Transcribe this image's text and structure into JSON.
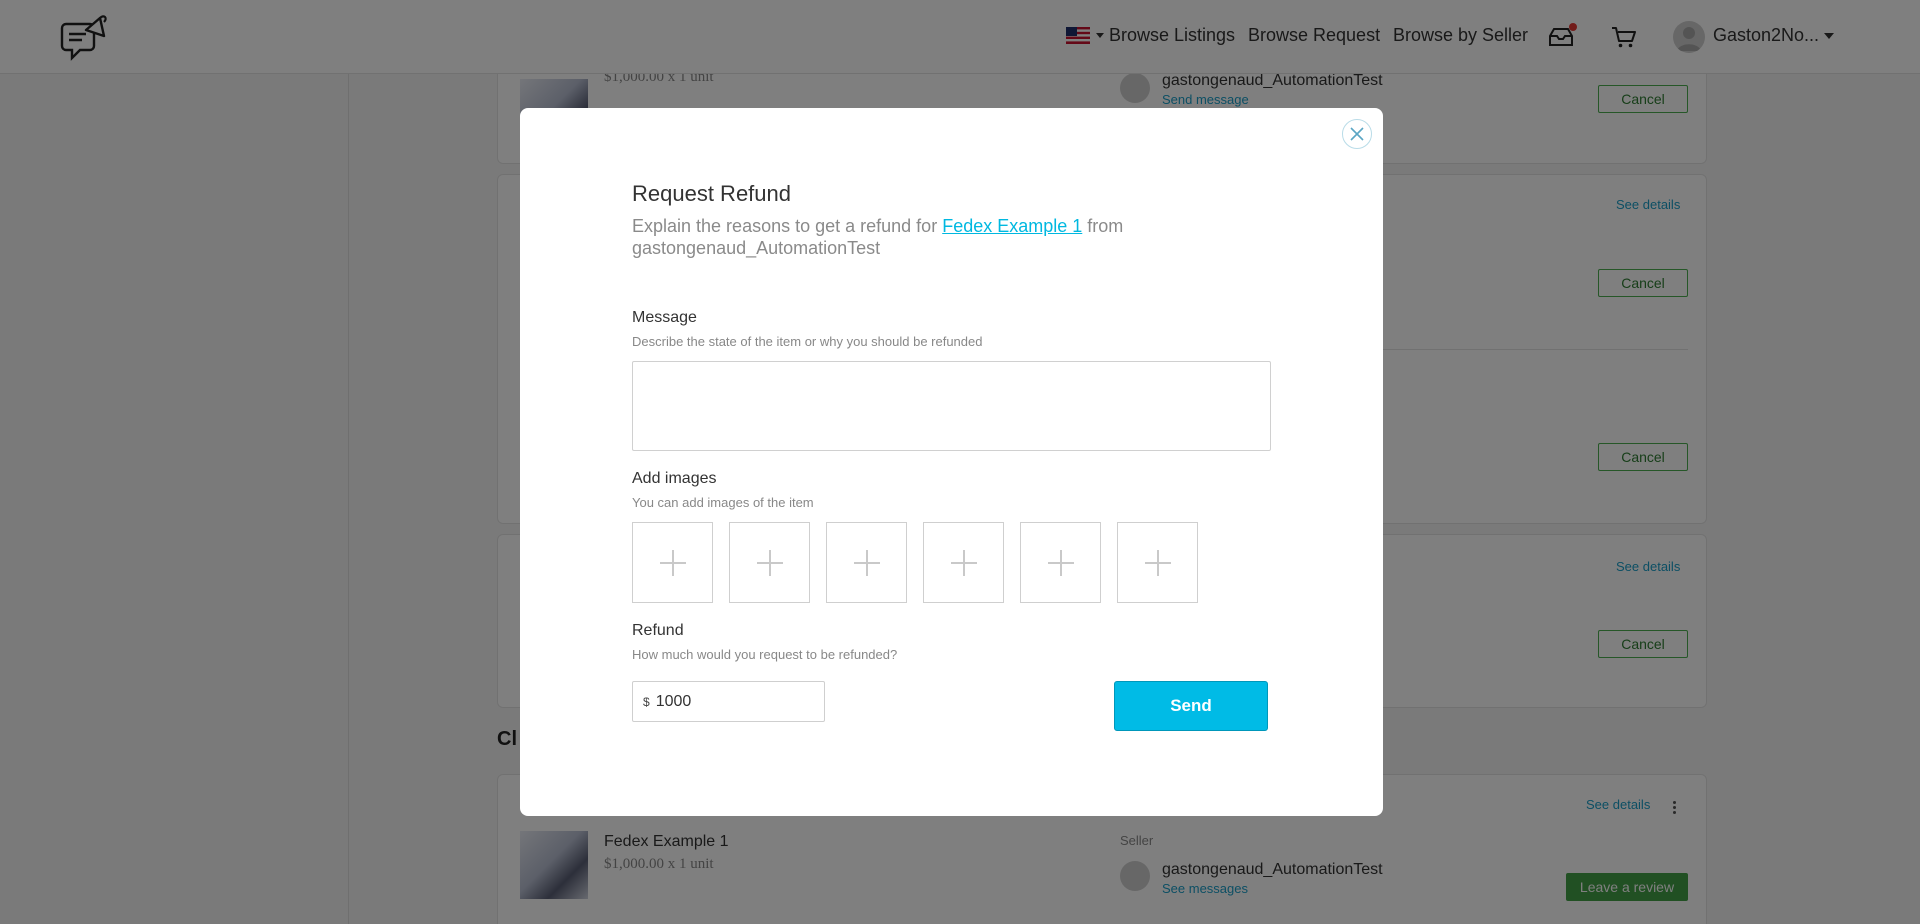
{
  "header": {
    "nav": {
      "browse_listings": "Browse Listings",
      "browse_request": "Browse Request",
      "browse_by_seller": "Browse by Seller"
    },
    "user_name": "Gaston2No..."
  },
  "background": {
    "card1": {
      "price": "$1,000.00 x 1 unit",
      "seller": "gastongenaud_AutomationTest",
      "send_message": "Send message",
      "cancel": "Cancel"
    },
    "card2": {
      "see_details": "See details",
      "cancel_a": "Cancel",
      "cancel_b": "Cancel"
    },
    "card3": {
      "see_details": "See details",
      "cancel": "Cancel"
    },
    "section_heading": "Cl",
    "closed_card": {
      "see_details": "See details",
      "title": "Fedex Example 1",
      "price": "$1,000.00 x 1 unit",
      "seller_label": "Seller",
      "seller": "gastongenaud_AutomationTest",
      "see_messages": "See messages",
      "leave_review": "Leave a review"
    }
  },
  "modal": {
    "title": "Request Refund",
    "subtitle_prefix": "Explain the reasons to get a refund for ",
    "subtitle_link": "Fedex Example 1",
    "subtitle_suffix": " from gastongenaud_AutomationTest",
    "message_label": "Message",
    "message_help": "Describe the state of the item or why you should be refunded",
    "message_value": "",
    "images_label": "Add images",
    "images_help": "You can add images of the item",
    "refund_label": "Refund",
    "refund_help": "How much would you request to be refunded?",
    "currency_symbol": "$",
    "refund_value": "1000",
    "send_label": "Send"
  },
  "colors": {
    "accent": "#00bbe6",
    "link": "#00b8e0",
    "success": "#43a047"
  },
  "icons": {
    "logo": "megaphone-chat-logo",
    "flag": "us-flag-icon",
    "inbox": "inbox-icon",
    "cart": "cart-icon",
    "close": "close-icon",
    "add": "plus-icon"
  }
}
